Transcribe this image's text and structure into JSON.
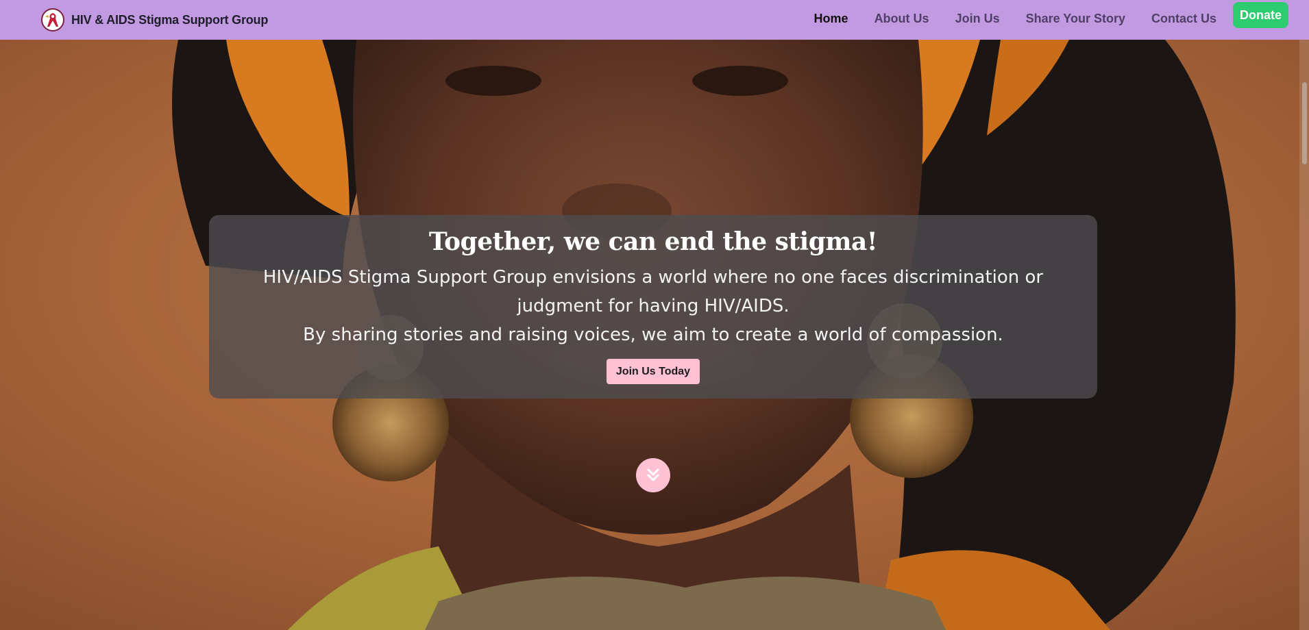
{
  "brand": {
    "name": "HIV & AIDS Stigma Support Group",
    "logo_icon": "ribbon-logo-icon"
  },
  "nav": {
    "items": [
      {
        "label": "Home",
        "active": true
      },
      {
        "label": "About Us",
        "active": false
      },
      {
        "label": "Join Us",
        "active": false
      },
      {
        "label": "Share Your Story",
        "active": false
      },
      {
        "label": "Contact Us",
        "active": false
      }
    ],
    "donate_label": "Donate"
  },
  "hero": {
    "title": "Together, we can end the stigma!",
    "lines": [
      "HIV/AIDS Stigma Support Group envisions a world where no one faces discrimination or judgment for having HIV/AIDS.",
      "By sharing stories and raising voices, we aim to create a world of compassion."
    ],
    "cta_label": "Join Us Today",
    "scroll_icon": "double-chevron-down-icon",
    "background_icon": "portrait-photo"
  },
  "colors": {
    "navbar": "#c29ae2",
    "donate": "#2ecc71",
    "cta": "#ffc1d4",
    "card": "#4e4c50"
  }
}
